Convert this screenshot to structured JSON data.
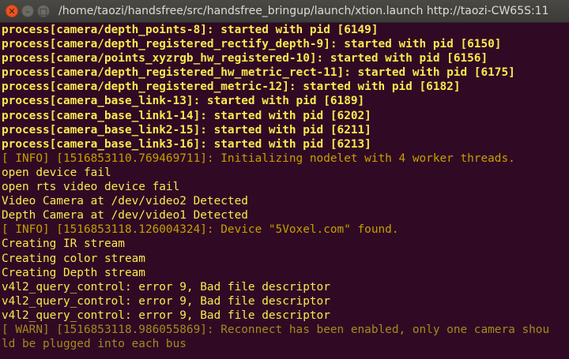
{
  "window": {
    "title": "/home/taozi/handsfree/src/handsfree_bringup/launch/xtion.launch http://taozi-CW65S:11",
    "buttons": {
      "close": "✕",
      "minimize": "–",
      "maximize": "□"
    }
  },
  "terminal": {
    "lines": [
      {
        "type": "proc",
        "text": "process[camera/depth_points-8]: started with pid [6149]"
      },
      {
        "type": "proc",
        "text": "process[camera/depth_registered_rectify_depth-9]: started with pid [6150]"
      },
      {
        "type": "proc",
        "text": "process[camera/points_xyzrgb_hw_registered-10]: started with pid [6156]"
      },
      {
        "type": "proc",
        "text": "process[camera/depth_registered_hw_metric_rect-11]: started with pid [6175]"
      },
      {
        "type": "proc",
        "text": "process[camera/depth_registered_metric-12]: started with pid [6182]"
      },
      {
        "type": "proc",
        "text": "process[camera_base_link-13]: started with pid [6189]"
      },
      {
        "type": "proc",
        "text": "process[camera_base_link1-14]: started with pid [6202]"
      },
      {
        "type": "proc",
        "text": "process[camera_base_link2-15]: started with pid [6211]"
      },
      {
        "type": "proc",
        "text": "process[camera_base_link3-16]: started with pid [6213]"
      },
      {
        "type": "info",
        "text": "[ INFO] [1516853110.769469711]: Initializing nodelet with 4 worker threads."
      },
      {
        "type": "plain",
        "text": "open device fail"
      },
      {
        "type": "plain",
        "text": "open rts video device fail"
      },
      {
        "type": "plain",
        "text": "Video Camera at /dev/video2 Detected"
      },
      {
        "type": "plain",
        "text": "Depth Camera at /dev/video1 Detected"
      },
      {
        "type": "info",
        "text": "[ INFO] [1516853118.126004324]: Device \"5Voxel.com\" found."
      },
      {
        "type": "plain",
        "text": "Creating IR stream"
      },
      {
        "type": "plain",
        "text": "Creating color stream"
      },
      {
        "type": "plain",
        "text": "Creating Depth stream"
      },
      {
        "type": "plain",
        "text": "v4l2_query_control: error 9, Bad file descriptor"
      },
      {
        "type": "plain",
        "text": "v4l2_query_control: error 9, Bad file descriptor"
      },
      {
        "type": "plain",
        "text": "v4l2_query_control: error 9, Bad file descriptor"
      },
      {
        "type": "warn",
        "text": "[ WARN] [1516853118.986055869]: Reconnect has been enabled, only one camera shou"
      },
      {
        "type": "warn",
        "text": "ld be plugged into each bus"
      }
    ]
  }
}
